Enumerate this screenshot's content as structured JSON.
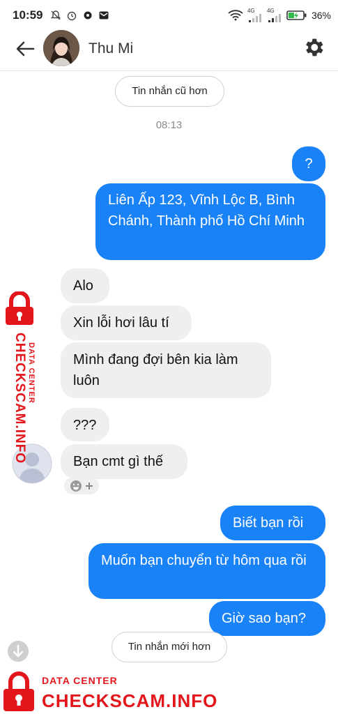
{
  "status": {
    "time": "10:59",
    "net1": "4G",
    "net2": "4G",
    "battery": "36%"
  },
  "header": {
    "contact_name": "Thu Mi"
  },
  "older_button": "Tin nhắn cũ hơn",
  "timestamp": "08:13",
  "messages": {
    "out1": "?",
    "out2": "Liên Ấp 123, Vĩnh Lộc B, Bình Chánh, Thành phố Hồ Chí Minh",
    "in1": "Alo",
    "in2": "Xin lỗi hơi lâu tí",
    "in3": "Mình đang đợi bên kia làm luôn",
    "in4": "???",
    "in5": "Bạn cmt gì thế",
    "out3": "Biết bạn rồi",
    "out4": "Muốn bạn chuyển từ hôm qua rồi",
    "out5": "Giờ sao bạn?"
  },
  "newer_button": "Tin nhắn mới hơn",
  "watermark": {
    "top": "DATA CENTER",
    "brand": "CHECKSCAM.INFO",
    "color": "#e3161b"
  },
  "colors": {
    "outgoing": "#1a82f7",
    "incoming": "#efeff1"
  }
}
